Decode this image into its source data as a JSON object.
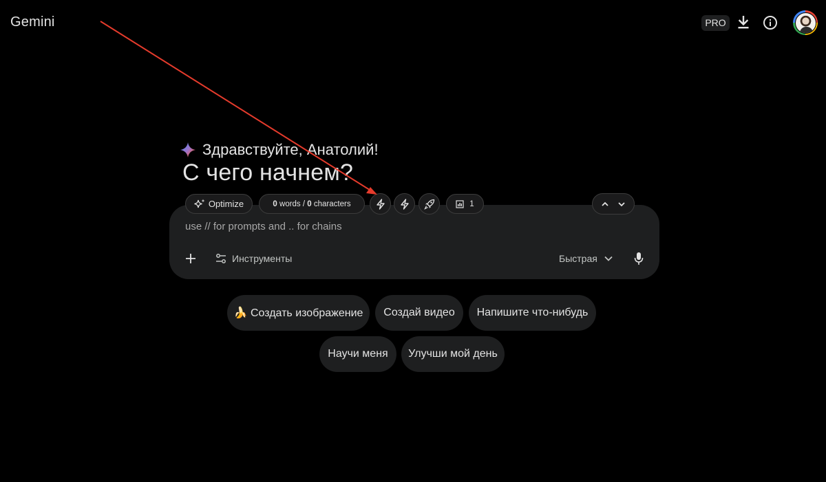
{
  "app": {
    "title": "Gemini"
  },
  "header": {
    "pro_badge": "PRO",
    "icons": [
      "download-icon",
      "info-icon"
    ],
    "avatar": "user-avatar"
  },
  "greeting": {
    "icon": "gemini-sparkle-icon",
    "text": "Здравствуйте, Анатолий!",
    "headline": "С чего начнем?"
  },
  "toolbar": {
    "optimize_label": "Optimize",
    "counter": {
      "words": "0",
      "words_label": " words / ",
      "chars": "0",
      "chars_label": " characters"
    },
    "icons": [
      "bolt-icon",
      "bolt-icon",
      "rocket-icon"
    ],
    "stats_count": "1"
  },
  "prompt": {
    "placeholder": "use // for prompts and .. for chains",
    "tools_label": "Инструменты",
    "model_label": "Быстрая"
  },
  "suggestions": {
    "row1": [
      "🍌 Создать изображение",
      "Создай видео",
      "Напишите что-нибудь"
    ],
    "row2": [
      "Научи меня",
      "Улучши мой день"
    ]
  },
  "colors": {
    "background": "#000000",
    "card": "#1e1f20",
    "text": "#e3e3e3",
    "annotation_arrow": "#e53b2c"
  }
}
